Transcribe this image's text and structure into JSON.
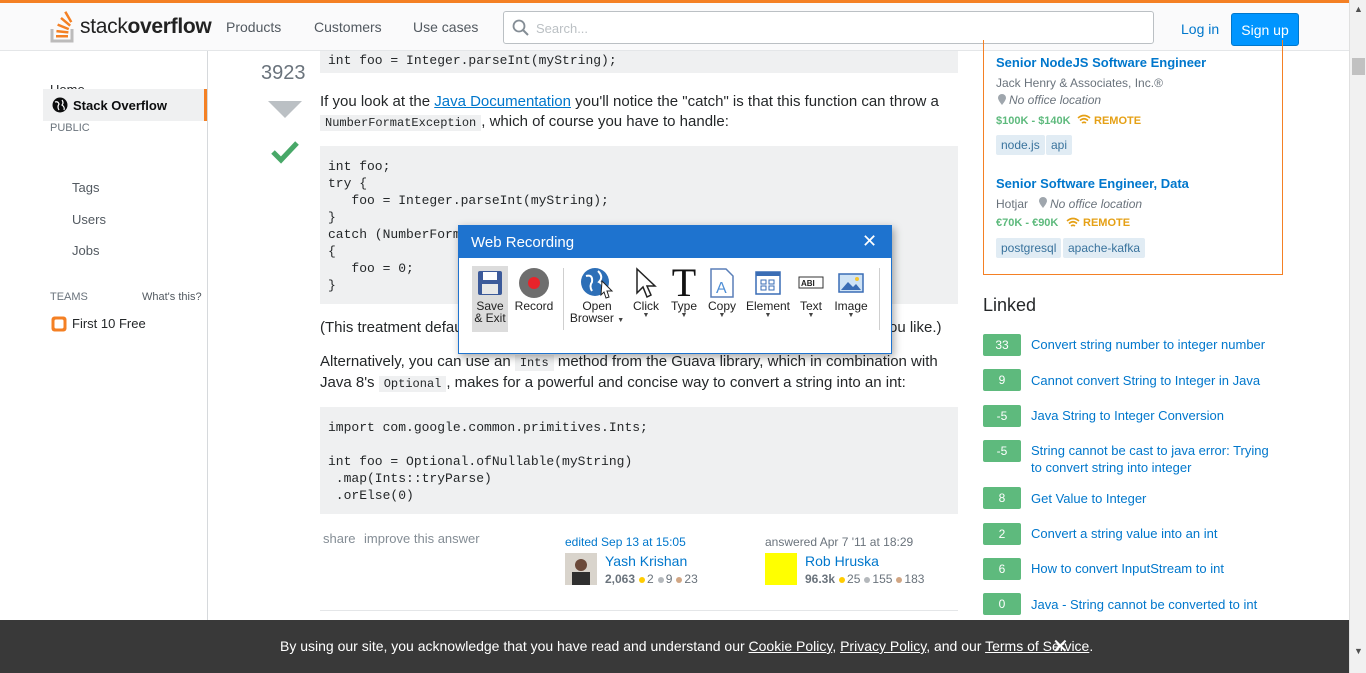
{
  "topbar": {
    "logo_text_1": "stack",
    "logo_text_2": "overflow",
    "nav": [
      "Products",
      "Customers",
      "Use cases"
    ],
    "search_placeholder": "Search...",
    "login": "Log in",
    "signup": "Sign up"
  },
  "leftnav": {
    "home": "Home",
    "public_header": "PUBLIC",
    "stack_overflow": "Stack Overflow",
    "tags": "Tags",
    "users": "Users",
    "jobs": "Jobs",
    "teams_header": "TEAMS",
    "whats_this": "What's this?",
    "first_10_free": "First 10 Free"
  },
  "answer": {
    "votes": "3923",
    "code1": "int foo = Integer.parseInt(myString);",
    "para1_pre": "If you look at the ",
    "para1_link": "Java Documentation",
    "para1_post": " you'll notice the \"catch\" is that this function can throw a",
    "para1_code": "NumberFormatException",
    "para1_end": ", which of course you have to handle:",
    "code2": [
      "int foo;",
      "try {",
      "   foo = Integer.parseInt(myString);",
      "}",
      "catch (NumberFormatException e)",
      "{",
      "   foo = 0;",
      "}"
    ],
    "para2_start": "(This treatment defau",
    "para2_end": "ou like.)",
    "para3_pre": "Alternatively, you can use an ",
    "para3_code1": "Ints",
    "para3_mid": " method from the Guava library, which in combination with",
    "para3_l2_pre": "Java 8's ",
    "para3_code2": "Optional",
    "para3_l2_post": ", makes for a powerful and concise way to convert a string into an int:",
    "code3": [
      "import com.google.common.primitives.Ints;",
      "",
      "int foo = Optional.ofNullable(myString)",
      " .map(Ints::tryParse)",
      " .orElse(0)"
    ],
    "share": "share",
    "improve": "improve this answer",
    "edited": "edited Sep 13 at 15:05",
    "editor_name": "Yash Krishan",
    "editor_rep": "2,063",
    "editor_gold": "2",
    "editor_silver": "9",
    "editor_bronze": "23",
    "answered": "answered Apr 7 '11 at 18:29",
    "answerer_name": "Rob Hruska",
    "answerer_rep": "96.3k",
    "answerer_gold": "25",
    "answerer_silver": "155",
    "answerer_bronze": "183"
  },
  "jobs": [
    {
      "title": "Senior NodeJS Software Engineer",
      "company": "Jack Henry & Associates, Inc.®",
      "location": "No office location",
      "salary": "$100K - $140K",
      "remote": "REMOTE",
      "tags": [
        "node.js",
        "api"
      ]
    },
    {
      "title": "Senior Software Engineer, Data",
      "company": "Hotjar",
      "location": "No office location",
      "salary": "€70K - €90K",
      "remote": "REMOTE",
      "tags": [
        "postgresql",
        "apache-kafka"
      ]
    }
  ],
  "linked": {
    "title": "Linked",
    "items": [
      {
        "score": "33",
        "text": "Convert string number to integer number"
      },
      {
        "score": "9",
        "text": "Cannot convert String to Integer in Java"
      },
      {
        "score": "-5",
        "text": "Java String to Integer Conversion"
      },
      {
        "score": "-5",
        "text": "String cannot be cast to java error: Trying to convert string into integer"
      },
      {
        "score": "8",
        "text": "Get Value to Integer"
      },
      {
        "score": "2",
        "text": "Convert a string value into an int"
      },
      {
        "score": "6",
        "text": "How to convert InputStream to int"
      },
      {
        "score": "0",
        "text": "Java - String cannot be converted to int"
      }
    ]
  },
  "cookie": {
    "pre": "By using our site, you acknowledge that you have read and understand our ",
    "cookie_policy": "Cookie Policy",
    "sep1": ", ",
    "privacy_policy": "Privacy Policy",
    "sep2": ", and our ",
    "terms": "Terms of Service",
    "end": ".",
    "close": "✕"
  },
  "web_recording": {
    "title": "Web Recording",
    "close": "✕",
    "save_l1": "Save",
    "save_l2": "& Exit",
    "record": "Record",
    "open_l1": "Open",
    "open_l2": "Browser",
    "click": "Click",
    "type": "Type",
    "copy": "Copy",
    "element": "Element",
    "text": "Text",
    "image": "Image"
  },
  "colors": {
    "accent": "#f48024",
    "link": "#0077cc",
    "dialog_blue": "#1e73cf",
    "linked_green": "#5eba7d"
  }
}
